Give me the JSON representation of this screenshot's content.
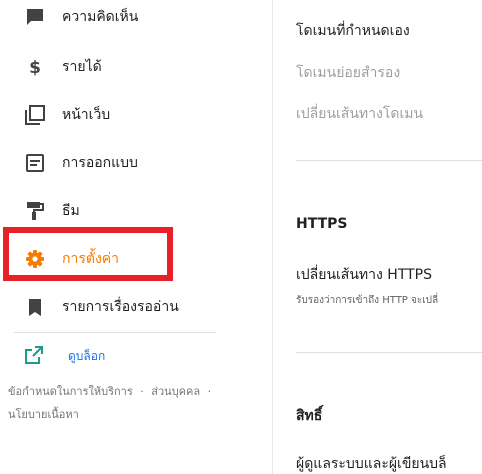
{
  "sidebar": {
    "items": [
      {
        "label": "ความคิดเห็น",
        "icon": "comment-icon"
      },
      {
        "label": "รายได้",
        "icon": "dollar-icon"
      },
      {
        "label": "หน้าเว็บ",
        "icon": "pages-icon"
      },
      {
        "label": "การออกแบบ",
        "icon": "layout-icon"
      },
      {
        "label": "ธีม",
        "icon": "paint-roller-icon"
      },
      {
        "label": "การตั้งค่า",
        "icon": "gear-icon"
      },
      {
        "label": "รายการเรื่องรออ่าน",
        "icon": "bookmark-icon"
      }
    ],
    "active_index": 5,
    "view_blog": {
      "label": "ดูบล็อก",
      "icon": "open-in-new-icon"
    },
    "footer": {
      "terms": "ข้อกำหนดในการให้บริการ",
      "privacy": "ส่วนบุคคล",
      "content_policy": "นโยบายเนื้อหา",
      "separator": "·"
    }
  },
  "colors": {
    "accent": "#f57c00",
    "highlight": "#e8202a",
    "link": "#1a73e8"
  },
  "settings": {
    "domain": {
      "title": "โดเมนที่กำหนดเอง",
      "sub1": "โดเมนย่อยสำรอง",
      "sub2": "เปลี่ยนเส้นทางโดเมน"
    },
    "https": {
      "section": "HTTPS",
      "redirect_title": "เปลี่ยนเส้นทาง HTTPS",
      "redirect_desc": "รับรองว่าการเข้าถึง HTTP จะเปลี่"
    },
    "permissions": {
      "section": "สิทธิ์",
      "row_title": "ผู้ดูแลระบบและผู้เขียนบล็"
    }
  }
}
